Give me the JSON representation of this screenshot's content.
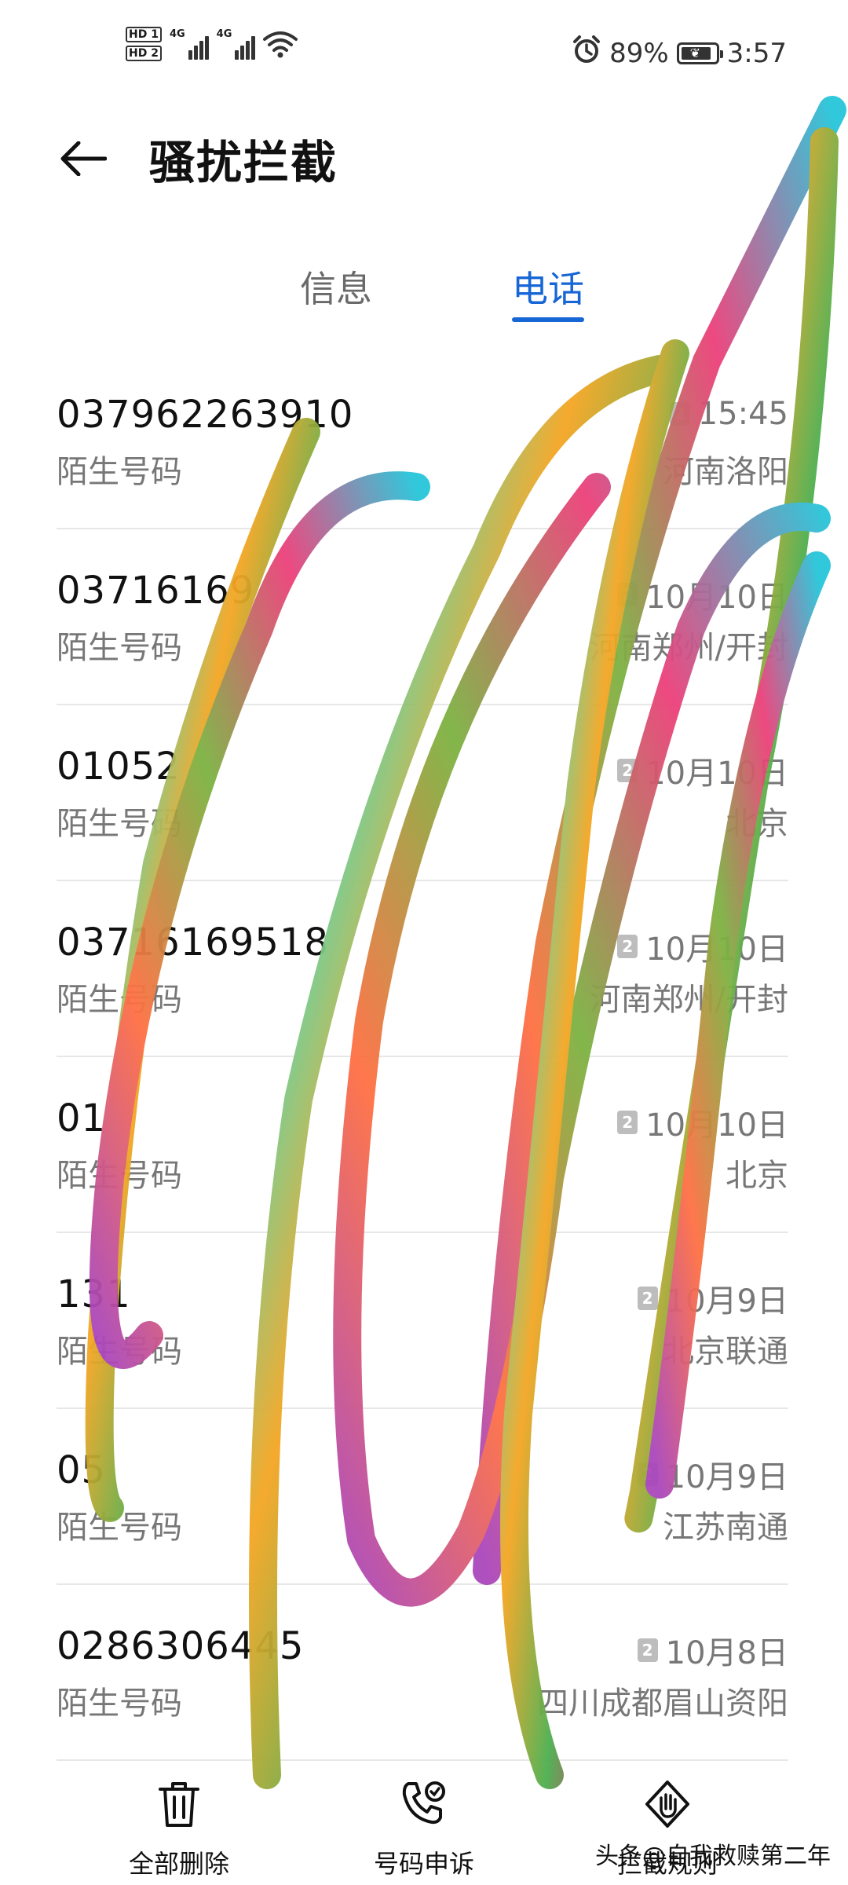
{
  "status_bar": {
    "sim1": "HD 1",
    "sim2": "HD 2",
    "network": "4G",
    "battery_percent": "89%",
    "battery_level": 0.89,
    "time": "3:57"
  },
  "header": {
    "title": "骚扰拦截"
  },
  "tabs": {
    "messages": "信息",
    "calls": "电话",
    "active": "calls"
  },
  "calls": [
    {
      "number": "037962263910",
      "label": "陌生号码",
      "sim": "2",
      "date": "15:45",
      "location": "河南洛阳"
    },
    {
      "number": "03716169",
      "label": "陌生号码",
      "sim": "2",
      "date": "10月10日",
      "location": "河南郑州/开封"
    },
    {
      "number": "01052",
      "label": "陌生号码",
      "sim": "2",
      "date": "10月10日",
      "location": "北京"
    },
    {
      "number": "03716169518",
      "label": "陌生号码",
      "sim": "2",
      "date": "10月10日",
      "location": "河南郑州/开封"
    },
    {
      "number": "01",
      "label": "陌生号码",
      "sim": "2",
      "date": "10月10日",
      "location": "北京"
    },
    {
      "number": "131",
      "label": "陌生号码",
      "sim": "2",
      "date": "10月9日",
      "location": "北京联通"
    },
    {
      "number": "05",
      "label": "陌生号码",
      "sim": "2",
      "date": "10月9日",
      "location": "江苏南通"
    },
    {
      "number": "0286306445",
      "label": "陌生号码",
      "sim": "2",
      "date": "10月8日",
      "location": "四川成都眉山资阳"
    }
  ],
  "toolbar": {
    "delete_all": "全部删除",
    "number_appeal": "号码申诉",
    "block_rules": "拦截规则"
  },
  "watermark": "头条@自我救赎第二年",
  "colors": {
    "accent": "#1766d6",
    "text_primary": "#111111",
    "text_secondary": "#777777",
    "divider": "#e7e7e7"
  }
}
